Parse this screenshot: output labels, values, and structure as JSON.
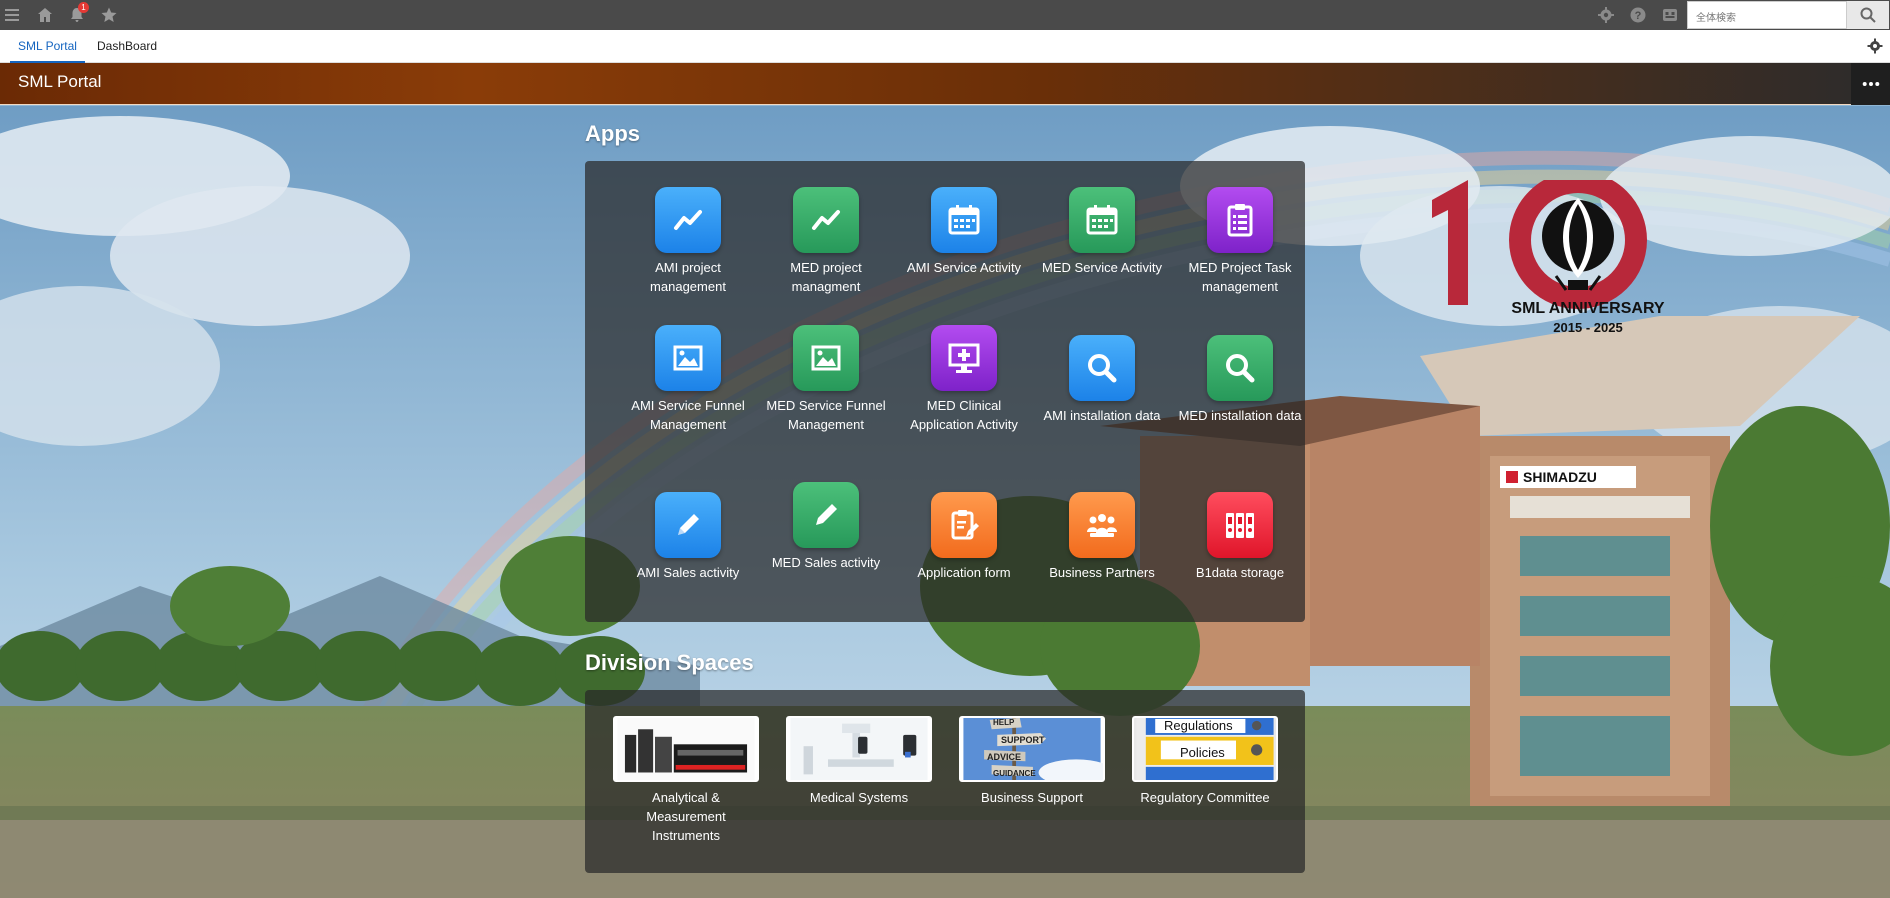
{
  "topbar": {
    "menu_icon": "hamburger-icon",
    "home_icon": "home-icon",
    "bell_icon": "bell-icon",
    "notification_count": "1",
    "favorite_icon": "star-icon",
    "search_placeholder": "全体検索"
  },
  "tabs": [
    {
      "label": "SML Portal",
      "active": true
    },
    {
      "label": "DashBoard",
      "active": false
    }
  ],
  "portal": {
    "title": "SML Portal"
  },
  "apps_section": {
    "title": "Apps",
    "items": [
      {
        "label": "AMI project management",
        "icon": "chart-trend-icon",
        "color": "blue"
      },
      {
        "label": "MED project managment",
        "icon": "chart-trend-icon",
        "color": "green"
      },
      {
        "label": "AMI Service Activity",
        "icon": "calendar-icon",
        "color": "blue"
      },
      {
        "label": "MED Service Activity",
        "icon": "calendar-icon",
        "color": "green"
      },
      {
        "label": "MED Project Task management",
        "icon": "clipboard-list-icon",
        "color": "purple"
      },
      {
        "label": "AMI Service Funnel Management",
        "icon": "image-icon",
        "color": "blue"
      },
      {
        "label": "MED Service Funnel Management",
        "icon": "image-icon",
        "color": "green"
      },
      {
        "label": "MED Clinical Application Activity",
        "icon": "monitor-plus-icon",
        "color": "purple"
      },
      {
        "label": "AMI installation data",
        "icon": "magnifier-icon",
        "color": "blue"
      },
      {
        "label": "MED installation data",
        "icon": "magnifier-icon",
        "color": "green"
      },
      {
        "label": "AMI Sales activity",
        "icon": "pencil-icon",
        "color": "blue"
      },
      {
        "label": "MED Sales activity",
        "icon": "pencil-icon",
        "color": "green"
      },
      {
        "label": "Application form",
        "icon": "clipboard-pen-icon",
        "color": "orange"
      },
      {
        "label": "Business Partners",
        "icon": "people-icon",
        "color": "orange"
      },
      {
        "label": "B1data storage",
        "icon": "binders-icon",
        "color": "red"
      }
    ]
  },
  "division_section": {
    "title": "Division Spaces",
    "items": [
      {
        "label": "Analytical & Measurement Instruments",
        "thumbnail": "instruments-photo"
      },
      {
        "label": "Medical Systems",
        "thumbnail": "medical-equipment-photo"
      },
      {
        "label": "Business Support",
        "thumbnail": "signpost-photo",
        "sign_words": [
          "HELP",
          "SUPPORT",
          "ADVICE",
          "GUIDANCE"
        ]
      },
      {
        "label": "Regulatory Committee",
        "thumbnail": "binders-photo",
        "binder_labels": [
          "Regulations",
          "Policies"
        ]
      }
    ]
  },
  "anniversary": {
    "number": "10",
    "line1": "SML ANNIVERSARY",
    "line2": "2015 - 2025",
    "color": "#b8283a"
  },
  "building_sign": "SHIMADZU"
}
